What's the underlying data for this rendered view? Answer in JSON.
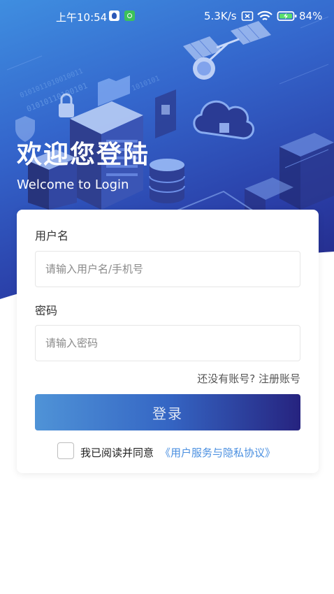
{
  "status_bar": {
    "time": "上午10:54",
    "network_speed": "5.3K/s",
    "battery": "84%"
  },
  "welcome": {
    "title": "欢迎您登陆",
    "subtitle": "Welcome to Login"
  },
  "form": {
    "username_label": "用户名",
    "username_placeholder": "请输入用户名/手机号",
    "username_value": "",
    "password_label": "密码",
    "password_placeholder": "请输入密码",
    "password_value": "",
    "register_link": "还没有账号? 注册账号",
    "login_button": "登录",
    "agree_text": "我已阅读并同意",
    "agreement_link": "《用户服务与隐私协议》",
    "agree_checked": false
  },
  "colors": {
    "hero_gradient_start": "#3f8ee0",
    "hero_gradient_end": "#22237f",
    "button_gradient_start": "#4f93d7",
    "button_gradient_end": "#26237f",
    "link_blue": "#4a8fe0"
  },
  "icons": {
    "status_app_icons": [
      "app-notification-icon",
      "wechat-icon"
    ],
    "status_right": [
      "sim-no-service-icon",
      "wifi-icon",
      "battery-charging-icon"
    ],
    "hero_illustrations": [
      "satellite-icon",
      "cloud-icon",
      "server-rack-icon",
      "lock-icon",
      "database-icon",
      "shield-icon",
      "folder-icon"
    ]
  }
}
